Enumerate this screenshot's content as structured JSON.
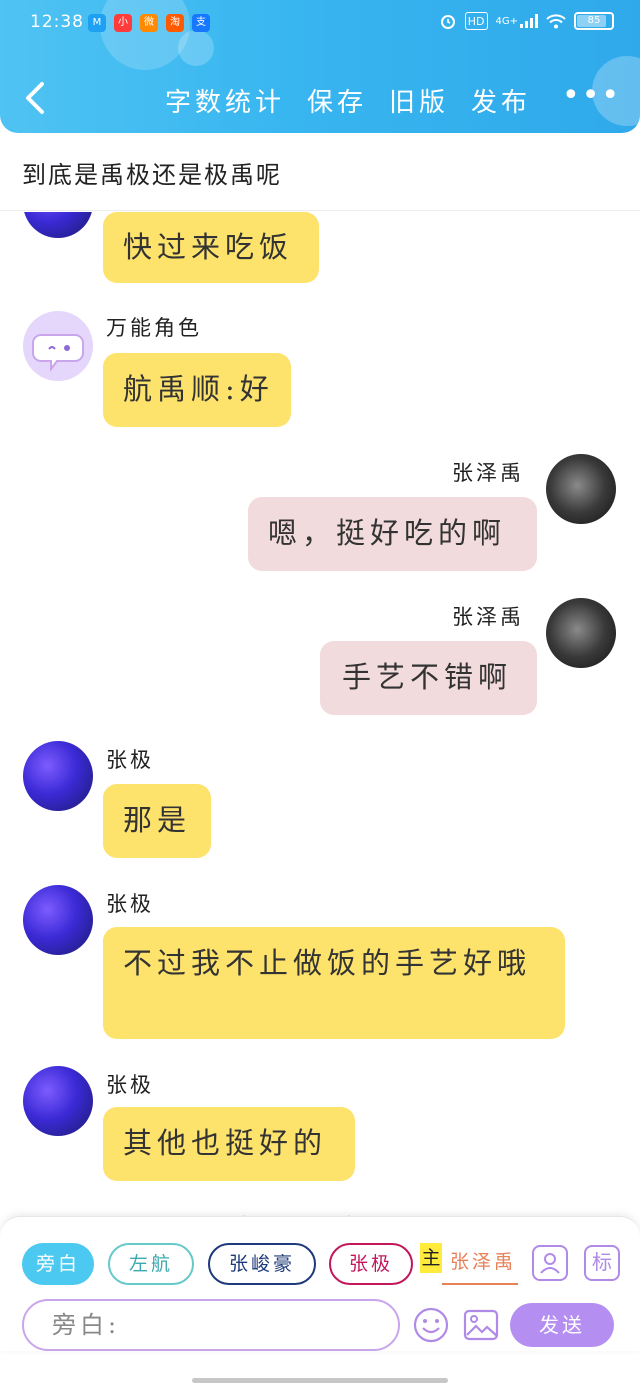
{
  "status_bar": {
    "time": "12:38",
    "apps": [
      {
        "name": "app-icon-1",
        "label": "M",
        "color": "#1ea1f2"
      },
      {
        "name": "app-icon-2",
        "label": "小",
        "color": "#ff3b3b"
      },
      {
        "name": "app-icon-3",
        "label": "微",
        "color": "#ff8a00"
      },
      {
        "name": "app-icon-4",
        "label": "淘",
        "color": "#ff5a00"
      },
      {
        "name": "app-icon-5",
        "label": "支",
        "color": "#1677ff"
      }
    ],
    "network": "4G+",
    "hd": "HD",
    "battery": "85"
  },
  "nav": {
    "word_count": "字数统计",
    "save": "保存",
    "old_version": "旧版",
    "publish": "发布",
    "more": "•••"
  },
  "title": "到底是禹极还是极禹呢",
  "messages": [
    {
      "speaker": "",
      "text": "快过来吃饭",
      "side": "left"
    },
    {
      "speaker": "万能角色",
      "text": "航禹顺:好",
      "side": "left"
    },
    {
      "speaker": "张泽禹",
      "text": "嗯，挺好吃的啊",
      "side": "right"
    },
    {
      "speaker": "张泽禹",
      "text": "手艺不错啊",
      "side": "right"
    },
    {
      "speaker": "张极",
      "text": "那是",
      "side": "left"
    },
    {
      "speaker": "张极",
      "text": "不过我不止做饭的手艺好哦",
      "side": "left"
    },
    {
      "speaker": "张极",
      "text": "其他也挺好的",
      "side": "left"
    }
  ],
  "partial_narration": "张泽禹表示不相信",
  "composer": {
    "chips": [
      "旁白",
      "左航",
      "张峻豪",
      "张极",
      "张泽禹"
    ],
    "main_mark": "主",
    "role_button": "角",
    "tag_button": "标",
    "input_placeholder": "旁白:",
    "send": "发送"
  }
}
